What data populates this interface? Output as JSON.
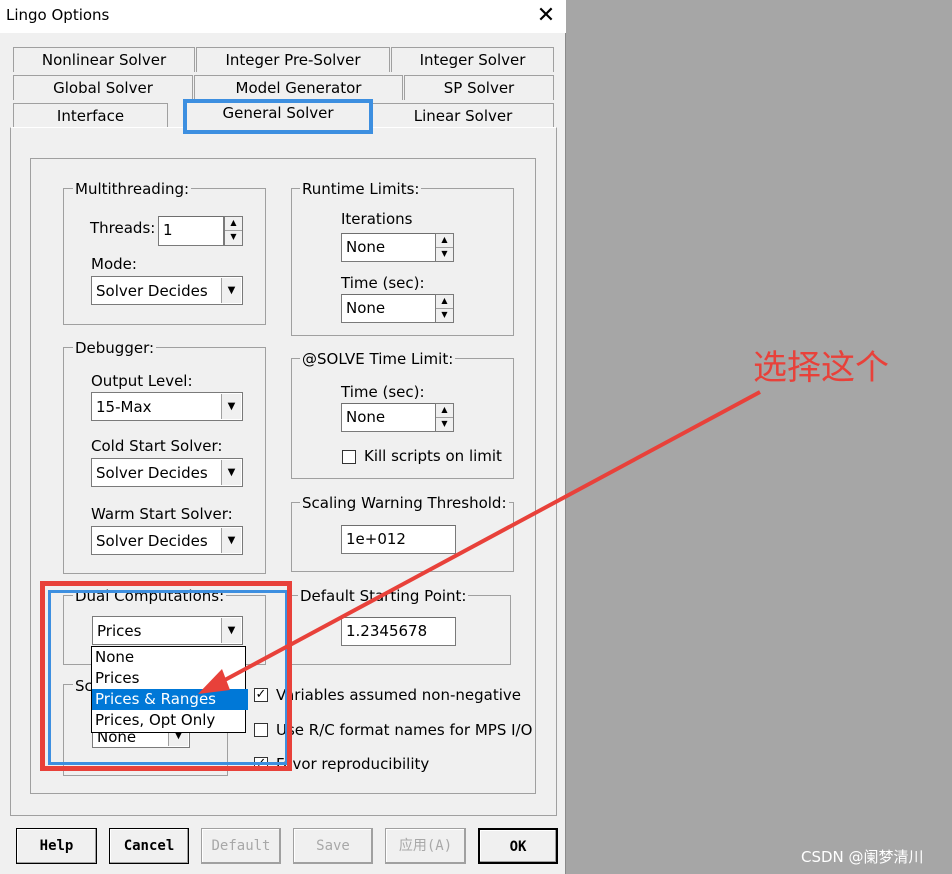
{
  "window": {
    "title": "Lingo Options",
    "close_glyph": "✕"
  },
  "tabs": {
    "row1": [
      "Nonlinear Solver",
      "Integer Pre-Solver",
      "Integer Solver"
    ],
    "row2": [
      "Global Solver",
      "Model Generator",
      "SP Solver"
    ],
    "row3": [
      "Interface",
      "General Solver",
      "Linear Solver"
    ],
    "active": "General Solver"
  },
  "multithreading": {
    "legend": "Multithreading:",
    "threads_label": "Threads:",
    "threads_value": "1",
    "mode_label": "Mode:",
    "mode_value": "Solver Decides"
  },
  "debugger": {
    "legend": "Debugger:",
    "output_level_label": "Output Level:",
    "output_level_value": "15-Max",
    "cold_start_label": "Cold Start Solver:",
    "cold_start_value": "Solver Decides",
    "warm_start_label": "Warm Start Solver:",
    "warm_start_value": "Solver Decides"
  },
  "runtime_limits": {
    "legend": "Runtime Limits:",
    "iterations_label": "Iterations",
    "iterations_value": "None",
    "time_label": "Time (sec):",
    "time_value": "None"
  },
  "solve_time_limit": {
    "legend": "@SOLVE Time Limit:",
    "time_label": "Time (sec):",
    "time_value": "None",
    "kill_label": "Kill scripts on limit",
    "kill_checked": false
  },
  "scaling": {
    "legend": "Scaling Warning Threshold:",
    "value": "1e+012"
  },
  "default_start": {
    "legend": "Default Starting Point:",
    "value": "1.2345678"
  },
  "dual": {
    "legend": "Dual Computations:",
    "value": "Prices",
    "options": [
      "None",
      "Prices",
      "Prices & Ranges",
      "Prices, Opt Only"
    ],
    "highlighted": "Prices & Ranges"
  },
  "hidden_group": {
    "legend_fragment": "Sc",
    "value_fragment": "None"
  },
  "checkboxes": [
    {
      "label": "Variables assumed non-negative",
      "checked": true
    },
    {
      "label": "Use R/C format names for MPS I/O",
      "checked": false
    },
    {
      "label": "Favor reproducibility",
      "checked": true
    }
  ],
  "buttons": {
    "help": "Help",
    "cancel": "Cancel",
    "default": "Default",
    "save": "Save",
    "apply": "应用(A)",
    "ok": "OK"
  },
  "annotation": {
    "text": "选择这个",
    "color": "#e8413a",
    "highlight_blue": "#3d8fe0",
    "highlight_red": "#e8413a"
  },
  "watermark": "CSDN @阑梦清川"
}
